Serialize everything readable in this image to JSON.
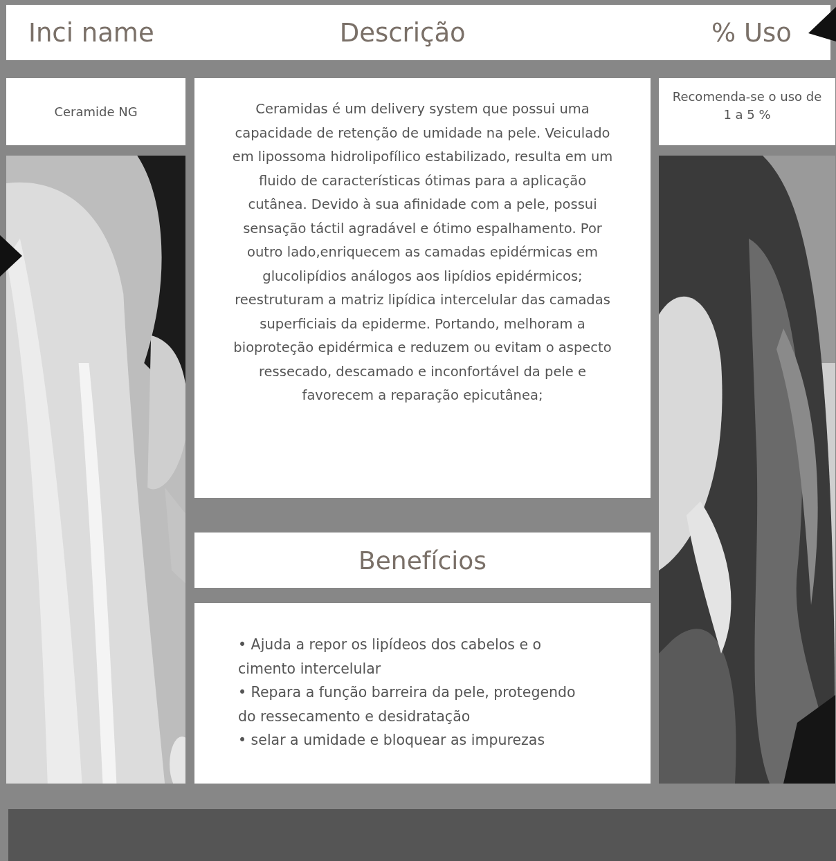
{
  "header": {
    "columns": [
      "Inci name",
      "Descrição",
      "% Uso"
    ]
  },
  "ingredient": {
    "inci_name": "Ceramide NG",
    "description": "Ceramidas é um delivery system que possui uma capacidade de retenção de umidade na pele. Veiculado em lipossoma hidrolipofílico estabilizado, resulta em um fluido de características ótimas para a aplicação cutânea. Devido à sua afinidade com a pele, possui sensação táctil agradável e ótimo espalhamento. Por outro lado,enriquecem as camadas epidérmicas em glucolipídios análogos aos lipídios epidérmicos; reestruturam a matriz lipídica intercelular das camadas superficiais da epiderme. Portando, melhoram a bioproteção epidérmica e reduzem ou evitam o aspecto ressecado, descamado e inconfortável da pele e favorecem a reparação epicutânea;",
    "usage": "Recomenda-se o uso de 1 a 5 %"
  },
  "benefits": {
    "title": "Benefícios",
    "items": [
      "• Ajuda a repor os lipídeos dos cabelos e o cimento intercelular",
      "• Repara a função barreira da pele, protegendo do ressecamento e desidratação",
      "• selar a umidade e bloquear as impurezas"
    ]
  }
}
